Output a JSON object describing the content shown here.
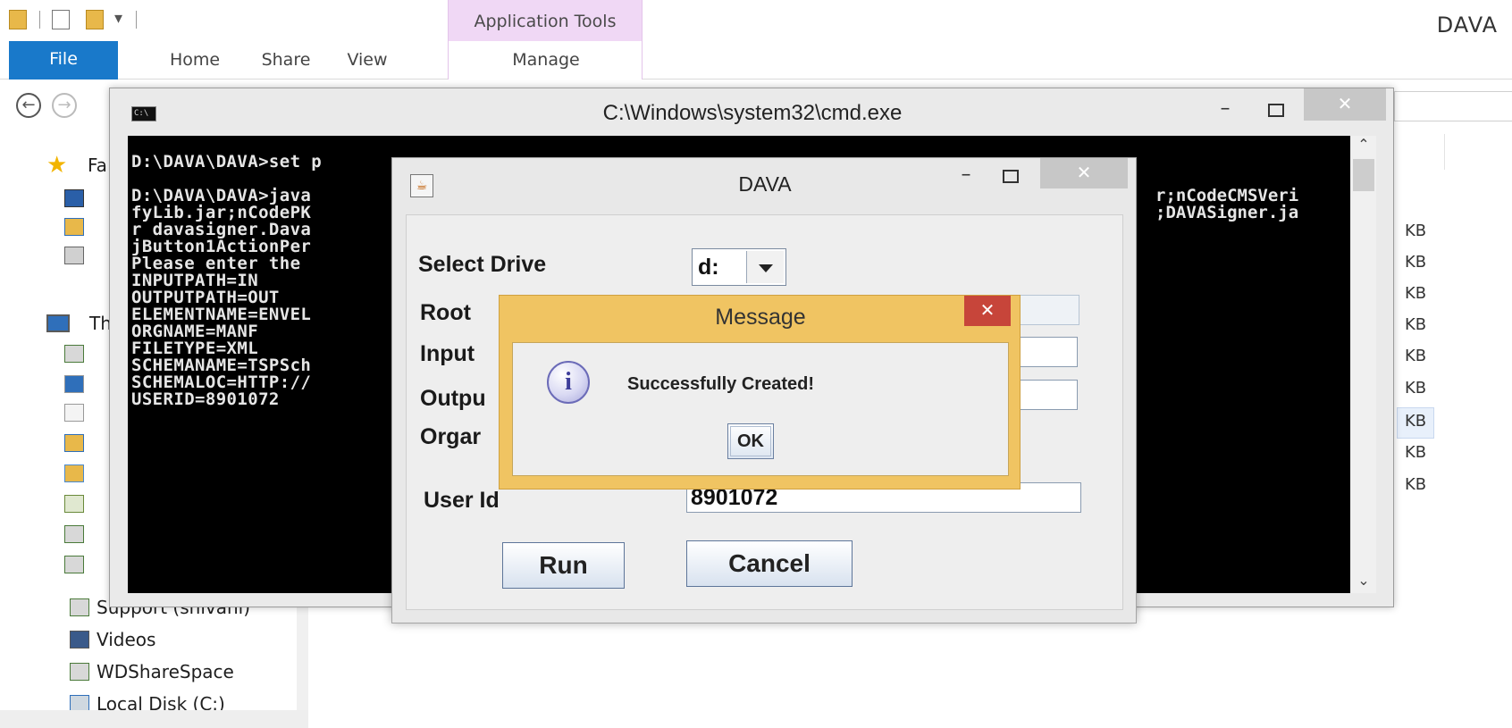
{
  "explorer": {
    "window_title": "DAVA",
    "context_tab_group": "Application Tools",
    "tabs": [
      "File",
      "Home",
      "Share",
      "View",
      "Manage"
    ],
    "favorites_label": "Fa",
    "this_pc_label": "Th",
    "nav_items": [
      "Support (shivani)",
      "Videos",
      "WDShareSpace",
      "Local Disk (C:)"
    ],
    "size_unit": "KB"
  },
  "cmd": {
    "title": "C:\\Windows\\system32\\cmd.exe",
    "close_glyph": "✕",
    "lines": [
      "D:\\DAVA\\DAVA>set p",
      "",
      "D:\\DAVA\\DAVA>java ",
      "fyLib.jar;nCodePK",
      "r davasigner.Dava",
      "jButton1ActionPer",
      "Please enter the ",
      "INPUTPATH=IN",
      "OUTPUTPATH=OUT",
      "ELEMENTNAME=ENVEL",
      "ORGNAME=MANF",
      "FILETYPE=XML",
      "SCHEMANAME=TSPSch",
      "SCHEMALOC=HTTP://",
      "USERID=8901072"
    ],
    "right_line_1": "r;nCodeCMSVeri",
    "right_line_2": ";DAVASigner.ja"
  },
  "dava": {
    "title": "DAVA",
    "close_glyph": "✕",
    "select_drive_label": "Select Drive",
    "drive_value": "d:",
    "root_label": "Root",
    "input_label": "Input",
    "output_label": "Outpu",
    "org_label": "Orgar",
    "user_id_label": "User Id",
    "user_id_value": "8901072",
    "run_label": "Run",
    "cancel_label": "Cancel"
  },
  "message": {
    "title": "Message",
    "close_glyph": "✕",
    "text": "Successfully Created!",
    "ok_label": "OK",
    "icon_glyph": "i"
  }
}
